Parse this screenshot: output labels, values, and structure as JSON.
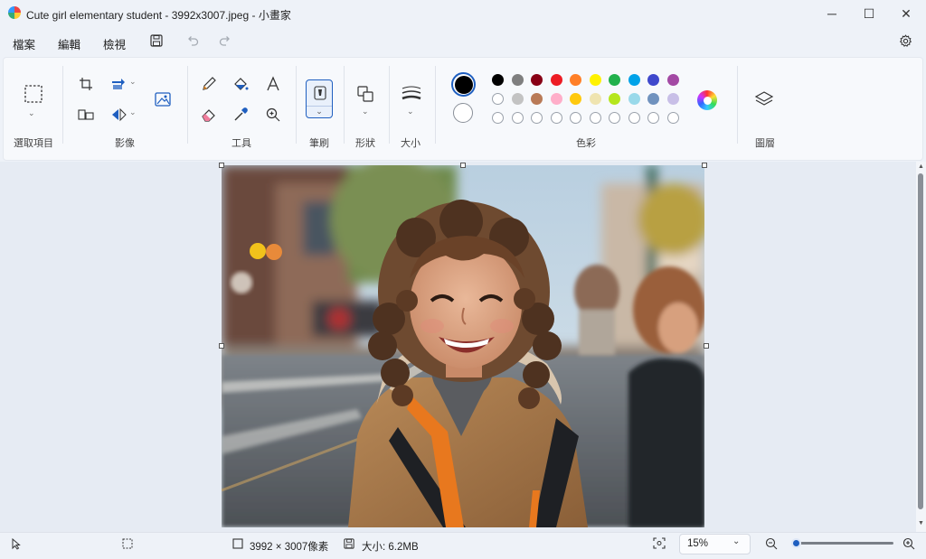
{
  "window": {
    "title": "Cute girl elementary student - 3992x3007.jpeg - 小畫家",
    "minimize": "─",
    "maximize": "☐",
    "close": "✕"
  },
  "menu": {
    "file": "檔案",
    "edit": "編輯",
    "view": "檢視"
  },
  "ribbon": {
    "groups": {
      "selection": "選取項目",
      "image": "影像",
      "tools": "工具",
      "brushes": "筆刷",
      "shapes": "形狀",
      "size": "大小",
      "colors": "色彩",
      "layers": "圖層"
    },
    "colors": {
      "primary": "#000000",
      "secondary": "#ffffff",
      "row1": [
        "#000000",
        "#7f7f7f",
        "#880015",
        "#ed1c24",
        "#ff7f27",
        "#fff200",
        "#22b14c",
        "#00a2e8",
        "#3f48cc",
        "#a349a4"
      ],
      "row2": [
        "#ffffff",
        "#c3c3c3",
        "#b97a57",
        "#ffaec9",
        "#ffc90e",
        "#efe4b0",
        "#b5e61d",
        "#99d9ea",
        "#7092be",
        "#c8bfe7"
      ],
      "row3_empty_count_label": ""
    }
  },
  "image": {
    "description_alt": "Cute girl elementary student"
  },
  "status": {
    "dimensions": "3992 × 3007像素",
    "file_size": "大小: 6.2MB",
    "zoom": "15%",
    "zoom_fraction": 0.15
  }
}
